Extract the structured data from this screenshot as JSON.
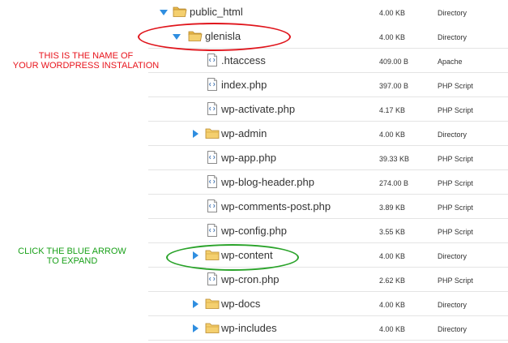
{
  "annotations": {
    "install_note_line1": "THIS IS THE NAME OF",
    "install_note_line2": "YOUR WORDPRESS INSTALATION",
    "expand_note_line1": "CLICK THE BLUE ARROW",
    "expand_note_line2": "TO EXPAND",
    "install_note_color": "#e8141c",
    "expand_note_color": "#1aa11a"
  },
  "tree": [
    {
      "name": "public_html",
      "size": "4.00 KB",
      "type": "Directory",
      "kind": "folder",
      "expander": "expanded",
      "level": 0
    },
    {
      "name": "glenisla",
      "size": "4.00 KB",
      "type": "Directory",
      "kind": "folder",
      "expander": "expanded",
      "level": 1
    },
    {
      "name": ".htaccess",
      "size": "409.00 B",
      "type": "Apache",
      "kind": "file",
      "expander": "none",
      "level": 2
    },
    {
      "name": "index.php",
      "size": "397.00 B",
      "type": "PHP Script",
      "kind": "file",
      "expander": "none",
      "level": 2
    },
    {
      "name": "wp-activate.php",
      "size": "4.17 KB",
      "type": "PHP Script",
      "kind": "file",
      "expander": "none",
      "level": 2
    },
    {
      "name": "wp-admin",
      "size": "4.00 KB",
      "type": "Directory",
      "kind": "folder",
      "expander": "collapsed",
      "level": 2
    },
    {
      "name": "wp-app.php",
      "size": "39.33 KB",
      "type": "PHP Script",
      "kind": "file",
      "expander": "none",
      "level": 2
    },
    {
      "name": "wp-blog-header.php",
      "size": "274.00 B",
      "type": "PHP Script",
      "kind": "file",
      "expander": "none",
      "level": 2
    },
    {
      "name": "wp-comments-post.php",
      "size": "3.89 KB",
      "type": "PHP Script",
      "kind": "file",
      "expander": "none",
      "level": 2
    },
    {
      "name": "wp-config.php",
      "size": "3.55 KB",
      "type": "PHP Script",
      "kind": "file",
      "expander": "none",
      "level": 2
    },
    {
      "name": "wp-content",
      "size": "4.00 KB",
      "type": "Directory",
      "kind": "folder",
      "expander": "collapsed",
      "level": 2
    },
    {
      "name": "wp-cron.php",
      "size": "2.62 KB",
      "type": "PHP Script",
      "kind": "file",
      "expander": "none",
      "level": 2
    },
    {
      "name": "wp-docs",
      "size": "4.00 KB",
      "type": "Directory",
      "kind": "folder",
      "expander": "collapsed",
      "level": 2
    },
    {
      "name": "wp-includes",
      "size": "4.00 KB",
      "type": "Directory",
      "kind": "folder",
      "expander": "collapsed",
      "level": 2
    }
  ],
  "colors": {
    "arrow_blue": "#2f8ee0",
    "folder_yellow": "#f4cf6e"
  }
}
